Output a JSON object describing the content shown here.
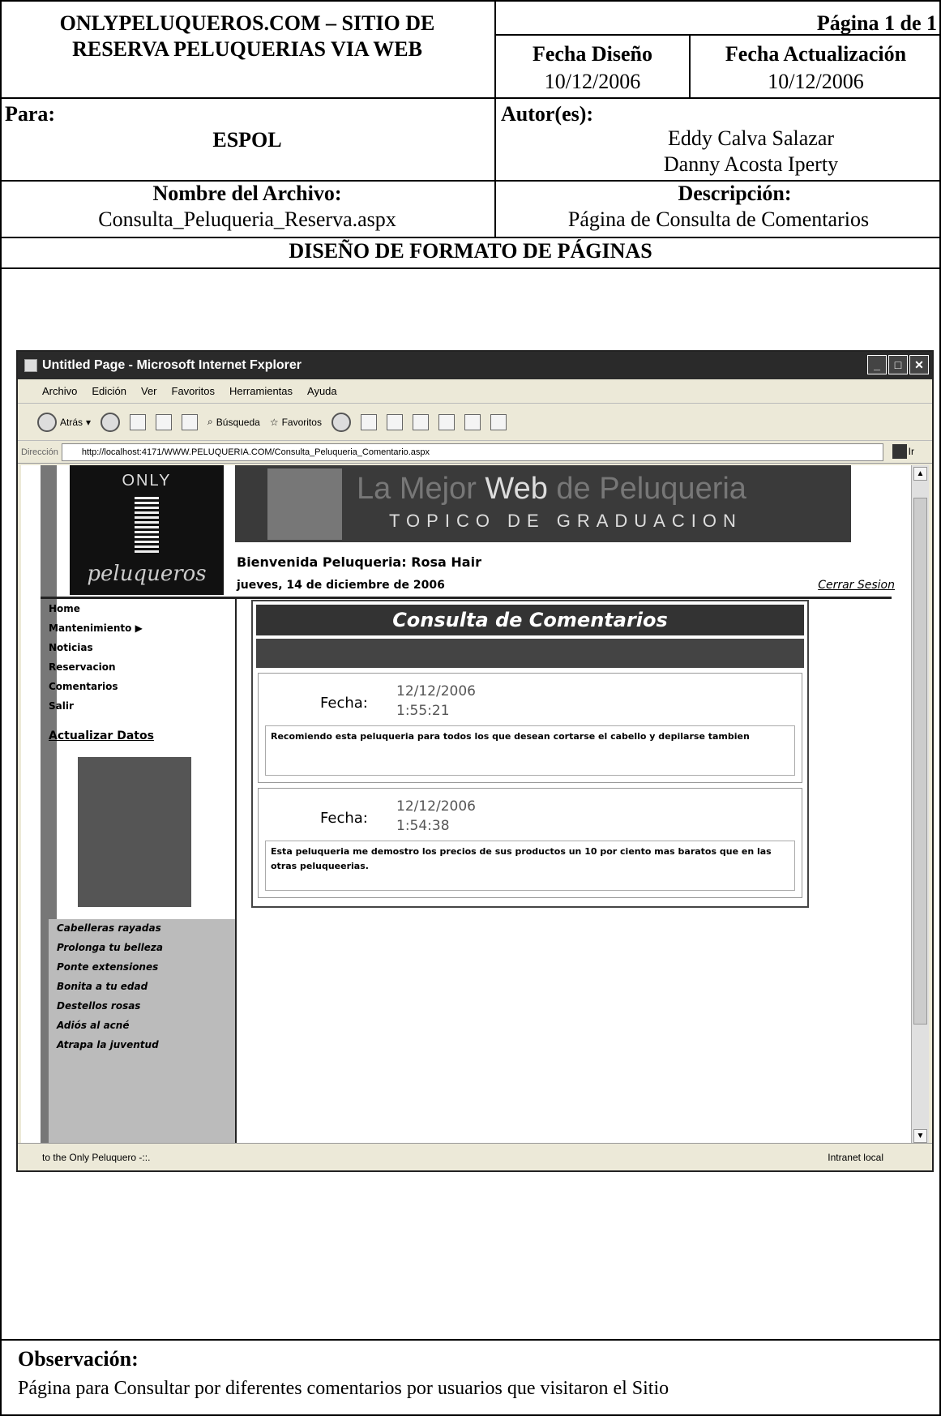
{
  "header": {
    "project_line1": "ONLYPELUQUEROS.COM – SITIO DE",
    "project_line2": "RESERVA PELUQUERIAS VIA WEB",
    "page": "Página 1 de 1",
    "fecha_diseno_label": "Fecha Diseño",
    "fecha_diseno": "10/12/2006",
    "fecha_act_label": "Fecha Actualización",
    "fecha_act": "10/12/2006",
    "para_label": "Para:",
    "para": "ESPOL",
    "autores_label": "Autor(es):",
    "autor1": "Eddy Calva Salazar",
    "autor2": "Danny Acosta Iperty",
    "archivo_label": "Nombre del Archivo:",
    "archivo": "Consulta_Peluqueria_Reserva.aspx",
    "descripcion_label": "Descripción:",
    "descripcion": "Página  de Consulta de Comentarios",
    "section": "DISEÑO DE FORMATO DE PÁGINAS"
  },
  "browser": {
    "title": "Untitled Page - Microsoft Internet Fxplorer",
    "menu": [
      "Archivo",
      "Edición",
      "Ver",
      "Favoritos",
      "Herramientas",
      "Ayuda"
    ],
    "back": "Atrás",
    "search": "Búsqueda",
    "favorites": "Favoritos",
    "address_label": "Dirección",
    "address": "http://localhost:4171/WWW.PELUQUERIA.COM/Consulta_Peluqueria_Comentario.aspx",
    "go": "Ir",
    "status": "to the Only Peluquero -::.",
    "zone": "Intranet local"
  },
  "site": {
    "logo_top": "ONLY",
    "logo_bottom": "peluqueros",
    "banner_pre": "La Mejor ",
    "banner_web": "Web",
    "banner_post": " de Peluqueria",
    "banner_sub": "TOPICO DE GRADUACION",
    "welcome": "Bienvenida Peluqueria: Rosa Hair",
    "date": "jueves, 14 de diciembre de 2006",
    "logout": "Cerrar Sesion",
    "nav": [
      "Home",
      "Mantenimiento  ▶",
      "Noticias",
      "Reservacion",
      "Comentarios",
      "Salir"
    ],
    "update": "Actualizar Datos",
    "tips": [
      "Cabelleras rayadas",
      "Prolonga tu belleza",
      "Ponte extensiones",
      "Bonita a tu edad",
      "Destellos rosas",
      "Adiós al acné",
      "Atrapa la juventud"
    ],
    "content_title": "Consulta  de Comentarios",
    "fecha_label": "Fecha:",
    "comments": [
      {
        "date": "12/12/2006",
        "time": "1:55:21",
        "text": "Recomiendo esta peluqueria para todos los que desean cortarse el cabello y depilarse tambien"
      },
      {
        "date": "12/12/2006",
        "time": "1:54:38",
        "text": "Esta peluqueria me demostro los precios de sus productos un 10 por ciento mas baratos que en las otras peluqueerias."
      }
    ]
  },
  "observacion_label": "Observación:",
  "observacion": "Página para Consultar por diferentes comentarios por   usuarios que visitaron el Sitio"
}
